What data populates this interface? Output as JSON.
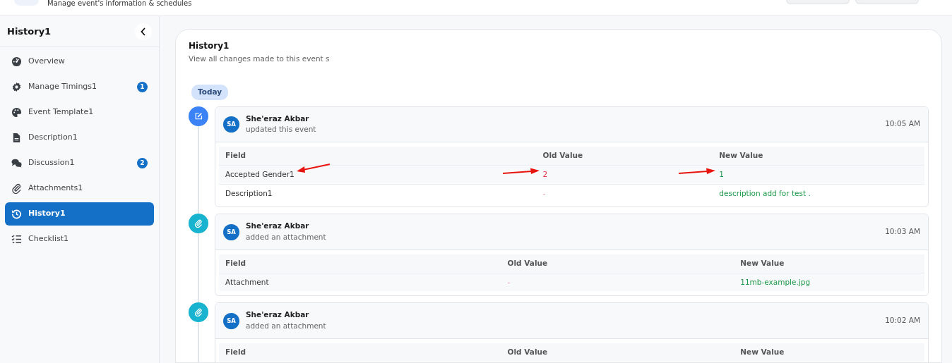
{
  "header": {
    "subtitle": "Manage event's information & schedules"
  },
  "sidebar": {
    "title": "History1",
    "items": [
      {
        "label": "Overview",
        "selected": false
      },
      {
        "label": "Manage Timings1",
        "selected": false,
        "badge": "1"
      },
      {
        "label": "Event Template1",
        "selected": false
      },
      {
        "label": "Description1",
        "selected": false
      },
      {
        "label": "Discussion1",
        "selected": false,
        "badge": "2"
      },
      {
        "label": "Attachments1",
        "selected": false
      },
      {
        "label": "History1",
        "selected": true
      },
      {
        "label": "Checklist1",
        "selected": false
      }
    ]
  },
  "history": {
    "title": "History1",
    "subtitle": "View all changes made to this event s",
    "date_label": "Today",
    "entries": [
      {
        "kind": "edit",
        "avatar": "SA",
        "user": "She'eraz Akbar",
        "action": "updated this event",
        "time": "10:05 AM",
        "columns": [
          "Field",
          "Old Value",
          "New Value"
        ],
        "rows": [
          {
            "field": "Accepted Gender1",
            "old": "2",
            "new": "1",
            "annotated": true
          },
          {
            "field": "Description1",
            "old": "-",
            "new": "description add for test .",
            "annotated": false
          }
        ]
      },
      {
        "kind": "attachment",
        "avatar": "SA",
        "user": "She'eraz Akbar",
        "action": "added an attachment",
        "time": "10:03 AM",
        "columns": [
          "Field",
          "Old Value",
          "New Value"
        ],
        "rows": [
          {
            "field": "Attachment",
            "old": "-",
            "new": "11mb-example.jpg",
            "annotated": false
          }
        ]
      },
      {
        "kind": "attachment",
        "avatar": "SA",
        "user": "She'eraz Akbar",
        "action": "added an attachment",
        "time": "10:02 AM",
        "columns": [
          "Field",
          "Old Value",
          "New Value"
        ]
      }
    ]
  }
}
